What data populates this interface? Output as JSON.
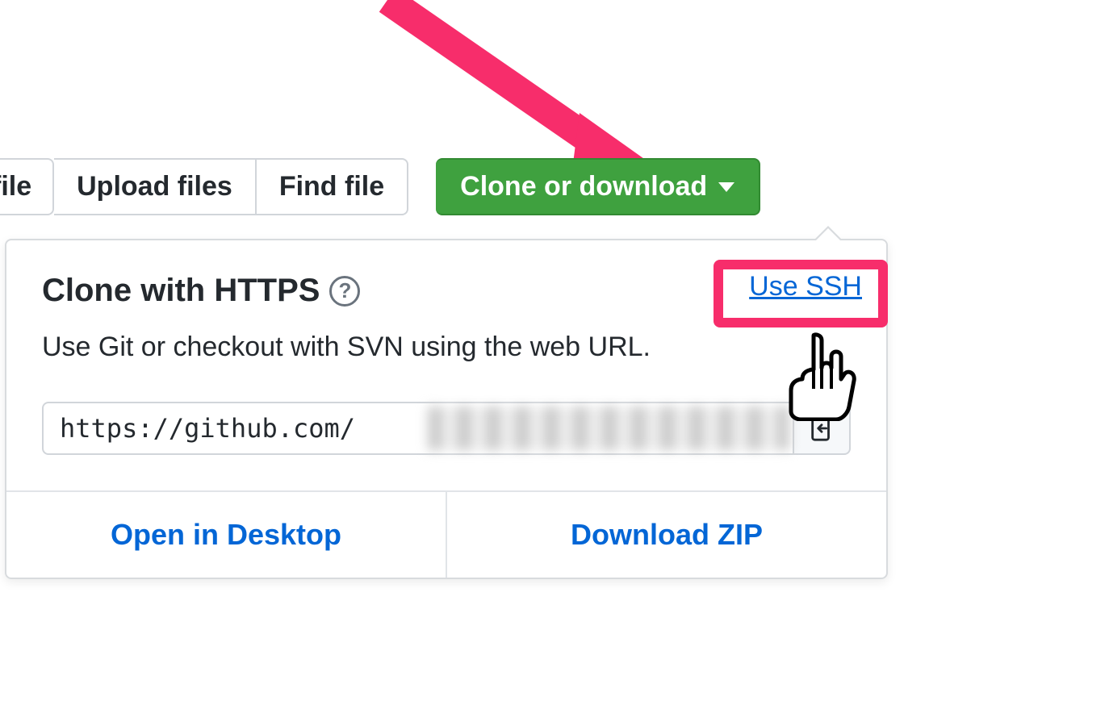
{
  "toolbar": {
    "new_file_partial": "file",
    "upload_label": "Upload files",
    "find_label": "Find file",
    "clone_label": "Clone or download"
  },
  "dropdown": {
    "title": "Clone with HTTPS",
    "help_glyph": "?",
    "use_ssh_label": "Use SSH",
    "description": "Use Git or checkout with SVN using the web URL.",
    "url_value": "https://github.com/",
    "open_desktop_label": "Open in Desktop",
    "download_zip_label": "Download ZIP"
  }
}
